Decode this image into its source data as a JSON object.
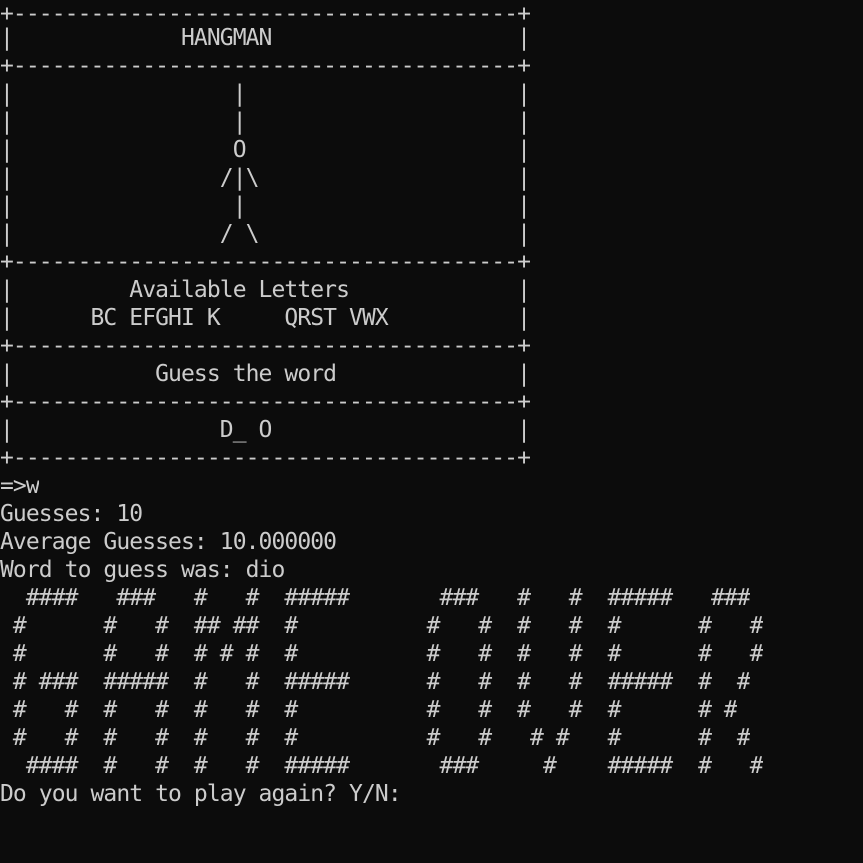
{
  "console": {
    "lines": [
      "+---------------------------------------+",
      "|             HANGMAN                   |",
      "+---------------------------------------+",
      "|                 |                     |",
      "|                 |                     |",
      "|                 O                     |",
      "|                /|\\                    |",
      "|                 |                     |",
      "|                / \\                    |",
      "+---------------------------------------+",
      "|         Available Letters             |",
      "|      BC EFGHI K     QRST VWX          |",
      "+---------------------------------------+",
      "|           Guess the word              |",
      "+---------------------------------------+",
      "|                D_ O                   |",
      "+---------------------------------------+",
      "=>w",
      "Guesses: 10",
      "Average Guesses: 10.000000",
      "Word to guess was: dio",
      "  ####   ###   #   #  #####       ###   #   #  #####   ###",
      " #      #   #  ## ##  #          #   #  #   #  #      #   #",
      " #      #   #  # # #  #          #   #  #   #  #      #   #",
      " # ###  #####  #   #  #####      #   #  #   #  #####  #  #",
      " #   #  #   #  #   #  #          #   #  #   #  #      # #",
      " #   #  #   #  #   #  #          #   #   # #   #      #  #",
      "  ####  #   #  #   #  #####       ###     #    #####  #   #",
      "Do you want to play again? Y/N:"
    ]
  }
}
